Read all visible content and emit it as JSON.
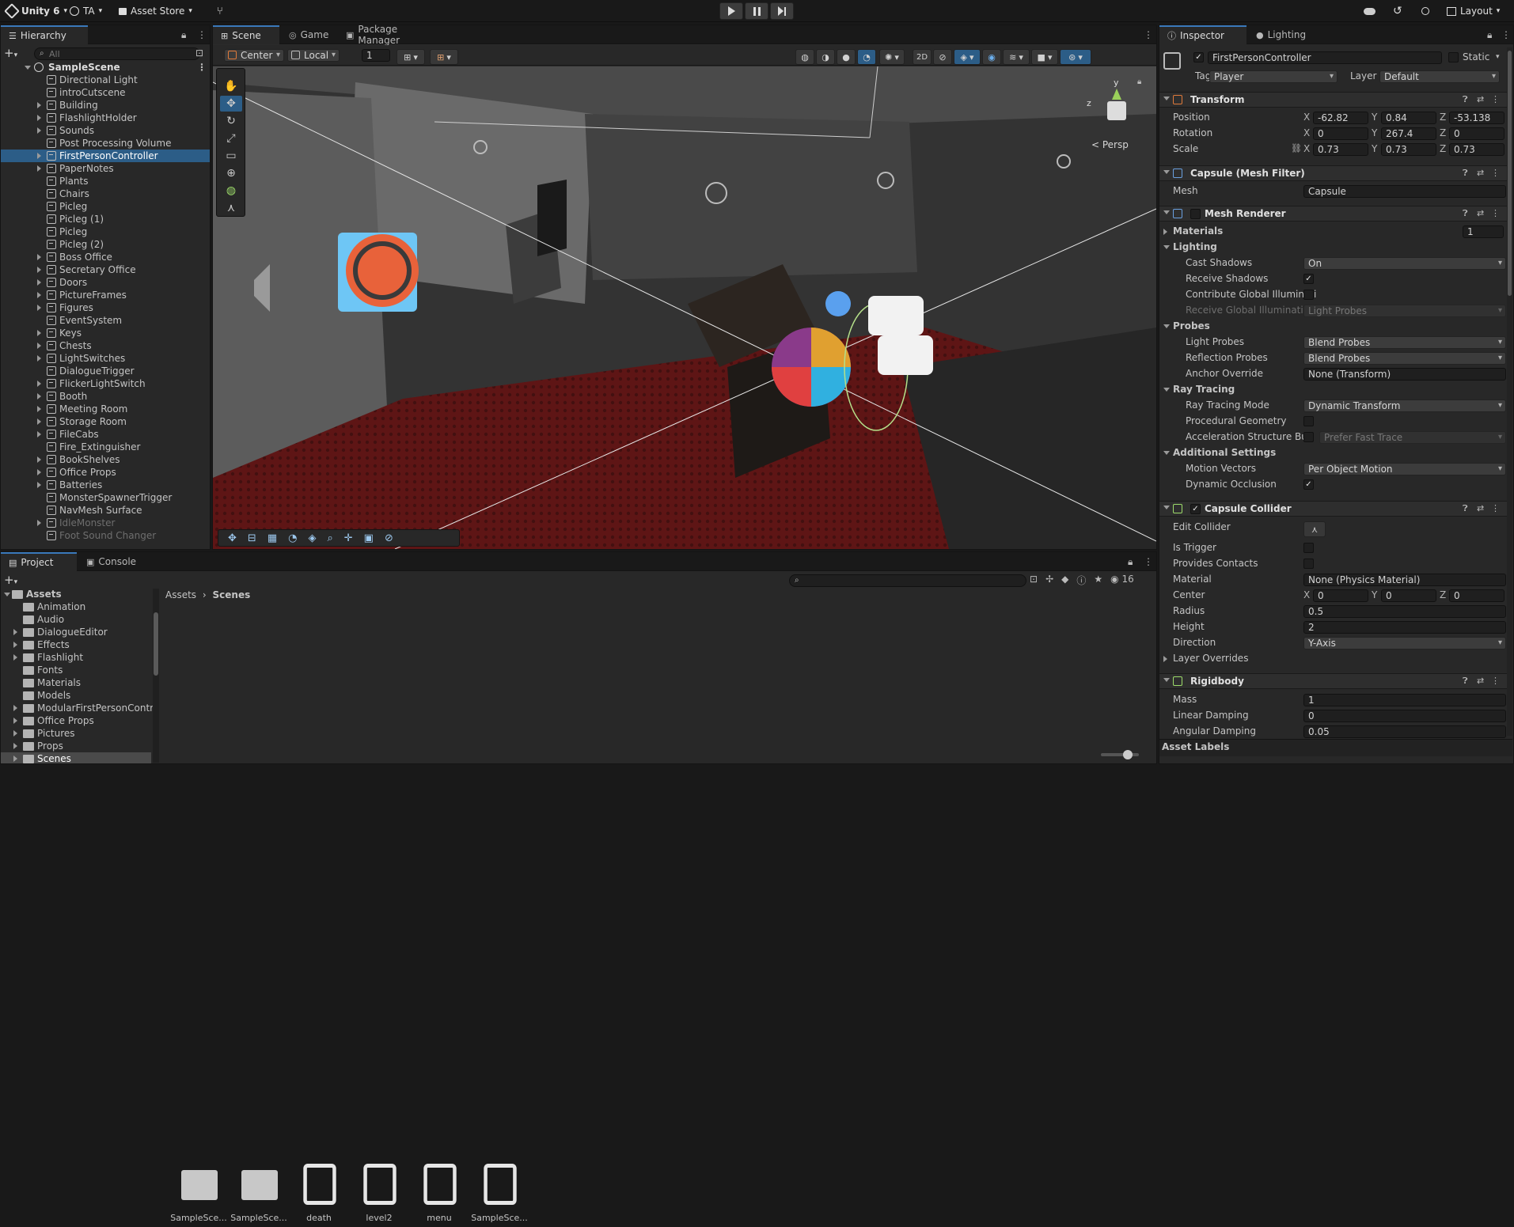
{
  "topbar": {
    "app_title": "Unity 6",
    "account": "TA",
    "asset_store": "Asset Store",
    "layout": "Layout"
  },
  "hierarchy": {
    "tab": "Hierarchy",
    "search_placeholder": "All",
    "scene": "SampleScene",
    "items": [
      {
        "label": "Directional Light",
        "foldable": false,
        "dim": false
      },
      {
        "label": "introCutscene",
        "foldable": false,
        "dim": false
      },
      {
        "label": "Building",
        "foldable": true,
        "dim": false
      },
      {
        "label": "FlashlightHolder",
        "foldable": true,
        "dim": false
      },
      {
        "label": "Sounds",
        "foldable": true,
        "dim": false
      },
      {
        "label": "Post Processing Volume",
        "foldable": false,
        "dim": false
      },
      {
        "label": "FirstPersonController",
        "foldable": true,
        "dim": false
      },
      {
        "label": "PaperNotes",
        "foldable": true,
        "dim": false
      },
      {
        "label": "Plants",
        "foldable": false,
        "dim": false
      },
      {
        "label": "Chairs",
        "foldable": false,
        "dim": false
      },
      {
        "label": "Picleg",
        "foldable": false,
        "dim": false
      },
      {
        "label": "Picleg (1)",
        "foldable": false,
        "dim": false
      },
      {
        "label": "Picleg",
        "foldable": false,
        "dim": false
      },
      {
        "label": "Picleg (2)",
        "foldable": false,
        "dim": false
      },
      {
        "label": "Boss Office",
        "foldable": true,
        "dim": false
      },
      {
        "label": "Secretary Office",
        "foldable": true,
        "dim": false
      },
      {
        "label": "Doors",
        "foldable": true,
        "dim": false
      },
      {
        "label": "PictureFrames",
        "foldable": true,
        "dim": false
      },
      {
        "label": "Figures",
        "foldable": true,
        "dim": false
      },
      {
        "label": "EventSystem",
        "foldable": false,
        "dim": false
      },
      {
        "label": "Keys",
        "foldable": true,
        "dim": false
      },
      {
        "label": "Chests",
        "foldable": true,
        "dim": false
      },
      {
        "label": "LightSwitches",
        "foldable": true,
        "dim": false
      },
      {
        "label": "DialogueTrigger",
        "foldable": false,
        "dim": false
      },
      {
        "label": "FlickerLightSwitch",
        "foldable": true,
        "dim": false
      },
      {
        "label": "Booth",
        "foldable": true,
        "dim": false
      },
      {
        "label": "Meeting Room",
        "foldable": true,
        "dim": false
      },
      {
        "label": "Storage Room",
        "foldable": true,
        "dim": false
      },
      {
        "label": "FileCabs",
        "foldable": true,
        "dim": false
      },
      {
        "label": "Fire_Extinguisher",
        "foldable": false,
        "dim": false
      },
      {
        "label": "BookShelves",
        "foldable": true,
        "dim": false
      },
      {
        "label": "Office Props",
        "foldable": true,
        "dim": false
      },
      {
        "label": "Batteries",
        "foldable": true,
        "dim": false
      },
      {
        "label": "MonsterSpawnerTrigger",
        "foldable": false,
        "dim": false
      },
      {
        "label": "NavMesh Surface",
        "foldable": false,
        "dim": false
      },
      {
        "label": "IdleMonster",
        "foldable": true,
        "dim": true
      },
      {
        "label": "Foot Sound Changer",
        "foldable": false,
        "dim": true
      }
    ]
  },
  "scene_view": {
    "tabs": [
      "Scene",
      "Game",
      "Package Manager"
    ],
    "pivot": "Center",
    "space": "Local",
    "grid_size": "1",
    "persp_label": "< Persp",
    "gizmo_y": "y",
    "gizmo_z": "z"
  },
  "inspector": {
    "tabs": [
      "Inspector",
      "Lighting"
    ],
    "object_name": "FirstPersonController",
    "static_label": "Static",
    "tag_label": "Tag",
    "tag_value": "Player",
    "layer_label": "Layer",
    "layer_value": "Default",
    "transform": {
      "title": "Transform",
      "position_label": "Position",
      "rotation_label": "Rotation",
      "scale_label": "Scale",
      "position": [
        "-62.82",
        "0.84",
        "-53.138"
      ],
      "rotation": [
        "0",
        "267.4",
        "0"
      ],
      "scale": [
        "0.73",
        "0.73",
        "0.73"
      ]
    },
    "axes": [
      "X",
      "Y",
      "Z"
    ],
    "mesh_filter": {
      "title": "Capsule (Mesh Filter)",
      "mesh_label": "Mesh",
      "mesh_value": "Capsule"
    },
    "mesh_renderer": {
      "title": "Mesh Renderer",
      "materials_label": "Materials",
      "materials_count": "1",
      "lighting_label": "Lighting",
      "cast_shadows_label": "Cast Shadows",
      "cast_shadows": "On",
      "receive_shadows_label": "Receive Shadows",
      "contribute_gi_label": "Contribute Global Illuminati",
      "receive_gi_label": "Receive Global Illumination",
      "receive_gi": "Light Probes",
      "probes_label": "Probes",
      "light_probes_label": "Light Probes",
      "light_probes": "Blend Probes",
      "reflection_probes_label": "Reflection Probes",
      "reflection_probes": "Blend Probes",
      "anchor_override_label": "Anchor Override",
      "anchor_override": "None (Transform)",
      "ray_tracing_label": "Ray Tracing",
      "ray_tracing_mode_label": "Ray Tracing Mode",
      "ray_tracing_mode": "Dynamic Transform",
      "procedural_geometry_label": "Procedural Geometry",
      "accel_structure_label": "Acceleration Structure Bui",
      "accel_structure": "Prefer Fast Trace",
      "additional_label": "Additional Settings",
      "motion_vectors_label": "Motion Vectors",
      "motion_vectors": "Per Object Motion",
      "dynamic_occlusion_label": "Dynamic Occlusion"
    },
    "capsule_collider": {
      "title": "Capsule Collider",
      "edit_collider_label": "Edit Collider",
      "is_trigger_label": "Is Trigger",
      "provides_contacts_label": "Provides Contacts",
      "material_label": "Material",
      "material": "None (Physics Material)",
      "center_label": "Center",
      "center": [
        "0",
        "0",
        "0"
      ],
      "radius_label": "Radius",
      "radius": "0.5",
      "height_label": "Height",
      "height": "2",
      "direction_label": "Direction",
      "direction": "Y-Axis",
      "layer_overrides_label": "Layer Overrides"
    },
    "rigidbody": {
      "title": "Rigidbody",
      "mass_label": "Mass",
      "mass": "1",
      "linear_damping_label": "Linear Damping",
      "linear_damping": "0",
      "angular_damping_label": "Angular Damping",
      "angular_damping": "0.05"
    },
    "asset_labels": "Asset Labels"
  },
  "project": {
    "tabs": [
      "Project",
      "Console"
    ],
    "root": "Assets",
    "folders": [
      "Animation",
      "Audio",
      "DialogueEditor",
      "Effects",
      "Flashlight",
      "Fonts",
      "Materials",
      "Models",
      "ModularFirstPersonContr",
      "Office Props",
      "Pictures",
      "Props",
      "Scenes"
    ],
    "breadcrumb": [
      "Assets",
      "Scenes"
    ],
    "visibility_count": "16",
    "assets": [
      {
        "name": "SampleSce...",
        "kind": "folder"
      },
      {
        "name": "SampleSce...",
        "kind": "folder"
      },
      {
        "name": "death",
        "kind": "unity"
      },
      {
        "name": "level2",
        "kind": "unity"
      },
      {
        "name": "menu",
        "kind": "unity"
      },
      {
        "name": "SampleSce...",
        "kind": "unity"
      }
    ]
  },
  "colors": {
    "selection": "#2c5d87",
    "tab_accent": "#3a79bb",
    "panel_bg": "#282828",
    "scene_floor": "#5a1414"
  }
}
